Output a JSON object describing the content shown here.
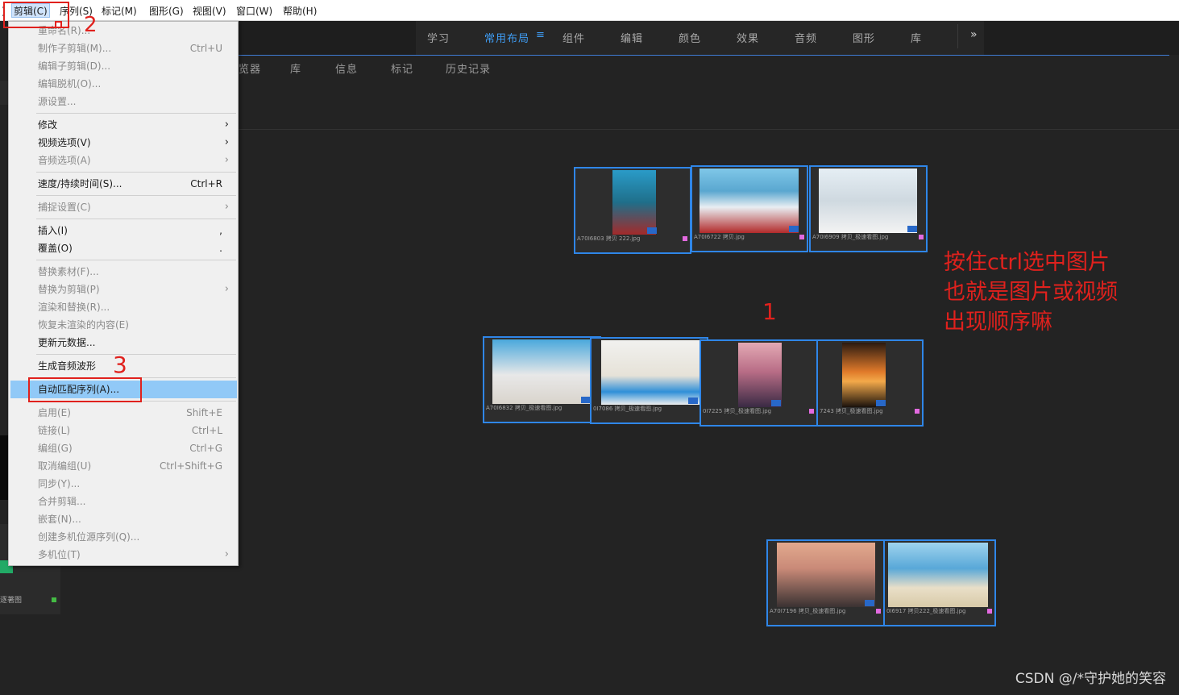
{
  "menubar": {
    "items": [
      "剪辑(C)",
      "序列(S)",
      "标记(M)",
      "图形(G)",
      "视图(V)",
      "窗口(W)",
      "帮助(H)"
    ]
  },
  "workspace": {
    "tabs": [
      "学习",
      "常用布局",
      "组件",
      "编辑",
      "颜色",
      "效果",
      "音频",
      "图形",
      "库"
    ],
    "active_tab": "常用布局",
    "more": "»"
  },
  "panel": {
    "tabs": [
      "览器",
      "库",
      "信息",
      "标记",
      "历史记录"
    ]
  },
  "dropdown": {
    "items": [
      {
        "label": "重命名(R)...",
        "shortcut": "",
        "arrow": false,
        "disabled": true
      },
      {
        "label": "制作子剪辑(M)...",
        "shortcut": "Ctrl+U",
        "arrow": false,
        "disabled": true
      },
      {
        "label": "编辑子剪辑(D)...",
        "shortcut": "",
        "arrow": false,
        "disabled": true
      },
      {
        "label": "编辑脱机(O)...",
        "shortcut": "",
        "arrow": false,
        "disabled": true
      },
      {
        "label": "源设置...",
        "shortcut": "",
        "arrow": false,
        "disabled": true
      },
      {
        "label": "修改",
        "shortcut": "",
        "arrow": true,
        "disabled": false
      },
      {
        "label": "视频选项(V)",
        "shortcut": "",
        "arrow": true,
        "disabled": false
      },
      {
        "label": "音频选项(A)",
        "shortcut": "",
        "arrow": true,
        "disabled": true
      },
      {
        "label": "速度/持续时间(S)...",
        "shortcut": "Ctrl+R",
        "arrow": false,
        "disabled": false
      },
      {
        "label": "捕捉设置(C)",
        "shortcut": "",
        "arrow": true,
        "disabled": true
      },
      {
        "label": "插入(I)",
        "shortcut": ",",
        "arrow": false,
        "disabled": false
      },
      {
        "label": "覆盖(O)",
        "shortcut": ".",
        "arrow": false,
        "disabled": false
      },
      {
        "label": "替换素材(F)...",
        "shortcut": "",
        "arrow": false,
        "disabled": true
      },
      {
        "label": "替换为剪辑(P)",
        "shortcut": "",
        "arrow": true,
        "disabled": true
      },
      {
        "label": "渲染和替换(R)...",
        "shortcut": "",
        "arrow": false,
        "disabled": true
      },
      {
        "label": "恢复未渲染的内容(E)",
        "shortcut": "",
        "arrow": false,
        "disabled": true
      },
      {
        "label": "更新元数据...",
        "shortcut": "",
        "arrow": false,
        "disabled": false
      },
      {
        "label": "生成音频波形",
        "shortcut": "",
        "arrow": false,
        "disabled": false
      },
      {
        "label": "自动匹配序列(A)...",
        "shortcut": "",
        "arrow": false,
        "disabled": false
      },
      {
        "label": "启用(E)",
        "shortcut": "Shift+E",
        "arrow": false,
        "disabled": true
      },
      {
        "label": "链接(L)",
        "shortcut": "Ctrl+L",
        "arrow": false,
        "disabled": true
      },
      {
        "label": "编组(G)",
        "shortcut": "Ctrl+G",
        "arrow": false,
        "disabled": true
      },
      {
        "label": "取消编组(U)",
        "shortcut": "Ctrl+Shift+G",
        "arrow": false,
        "disabled": true
      },
      {
        "label": "同步(Y)...",
        "shortcut": "",
        "arrow": false,
        "disabled": true
      },
      {
        "label": "合并剪辑...",
        "shortcut": "",
        "arrow": false,
        "disabled": true
      },
      {
        "label": "嵌套(N)...",
        "shortcut": "",
        "arrow": false,
        "disabled": true
      },
      {
        "label": "创建多机位源序列(Q)...",
        "shortcut": "",
        "arrow": false,
        "disabled": true
      },
      {
        "label": "多机位(T)",
        "shortcut": "",
        "arrow": true,
        "disabled": true
      }
    ]
  },
  "annotations": {
    "step1": "1",
    "step2": "2",
    "step3": "3",
    "note_lines": [
      "按住ctrl选中图片",
      "也就是图片或视频",
      "出现顺序嘛"
    ]
  },
  "thumbnails": [
    {
      "caption": "A70I6803 拷贝 222.jpg"
    },
    {
      "caption": "A70I6722 拷贝.jpg"
    },
    {
      "caption": "A70I6909 拷贝_极速看图.jpg"
    },
    {
      "caption": "A70I6832 拷贝_极速看图.jpg"
    },
    {
      "caption": "0I7086 拷贝_极速看图.jpg"
    },
    {
      "caption": "0I7225 拷贝_极速看图.jpg"
    },
    {
      "caption": "7243 拷贝_极速看图.jpg"
    },
    {
      "caption": "A70I7196 拷贝_极速看图.jpg"
    },
    {
      "caption": "0I6917 拷贝222_极速看图.jpg"
    }
  ],
  "left_panel": {
    "label": "逐著图"
  },
  "watermark": "CSDN @/*守护她的笑容"
}
